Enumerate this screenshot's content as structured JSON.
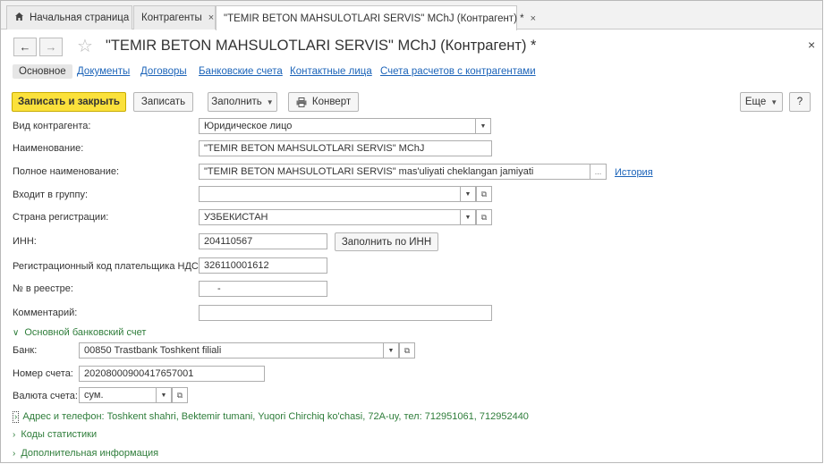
{
  "tabs": [
    {
      "label": "Начальная страница",
      "icon": "home-icon"
    },
    {
      "label": "Контрагенты",
      "close": "×"
    },
    {
      "label": "\"TEMIR BETON MAHSULOTLARI SERVIS\" MChJ (Контрагент) *",
      "close": "×"
    }
  ],
  "header": {
    "back": "←",
    "forward": "→",
    "star": "☆",
    "title": "\"TEMIR BETON MAHSULOTLARI SERVIS\" MChJ (Контрагент) *",
    "close": "×"
  },
  "subtabs": [
    "Основное",
    "Документы",
    "Договоры",
    "Банковские счета",
    "Контактные лица",
    "Счета расчетов с контрагентами"
  ],
  "toolbar": {
    "save_close": "Записать и закрыть",
    "save": "Записать",
    "fill": "Заполнить",
    "envelope": "Конверт",
    "more": "Еще",
    "help": "?"
  },
  "form": {
    "type_label": "Вид контрагента:",
    "type_value": "Юридическое лицо",
    "name_label": "Наименование:",
    "name_value": "\"TEMIR BETON MAHSULOTLARI SERVIS\" MChJ",
    "fullname_label": "Полное наименование:",
    "fullname_value": "\"TEMIR BETON MAHSULOTLARI SERVIS\" mas'uliyati cheklangan jamiyati",
    "fullname_more": "...",
    "history_link": "История",
    "group_label": "Входит в группу:",
    "group_value": "",
    "country_label": "Страна регистрации:",
    "country_value": "УЗБЕКИСТАН",
    "inn_label": "ИНН:",
    "inn_value": "204110567",
    "inn_fill_button": "Заполнить по ИНН",
    "vat_label": "Регистрационный код плательщика НДС:",
    "vat_value": "326110001612",
    "registry_label": "№ в реестре:",
    "registry_value": "-",
    "comment_label": "Комментарий:",
    "comment_value": ""
  },
  "bank": {
    "group_title": "Основной банковский счет",
    "bank_label": "Банк:",
    "bank_value": "00850 Trastbank Toshkent filiali",
    "account_label": "Номер счета:",
    "account_value": "20208000900417657001",
    "currency_label": "Валюта счета:",
    "currency_value": "сум."
  },
  "collapsed_groups": {
    "address": "Адрес и телефон: Toshkent shahri, Bektemir tumani, Yuqori Chirchiq ko'chasi, 72A-uy, тел: 712951061, 712952440",
    "stats": "Коды статистики",
    "extra": "Дополнительная информация"
  },
  "colors": {
    "accent": "#fbe13b",
    "link": "#1c64b9",
    "group": "#2e7d3a"
  }
}
